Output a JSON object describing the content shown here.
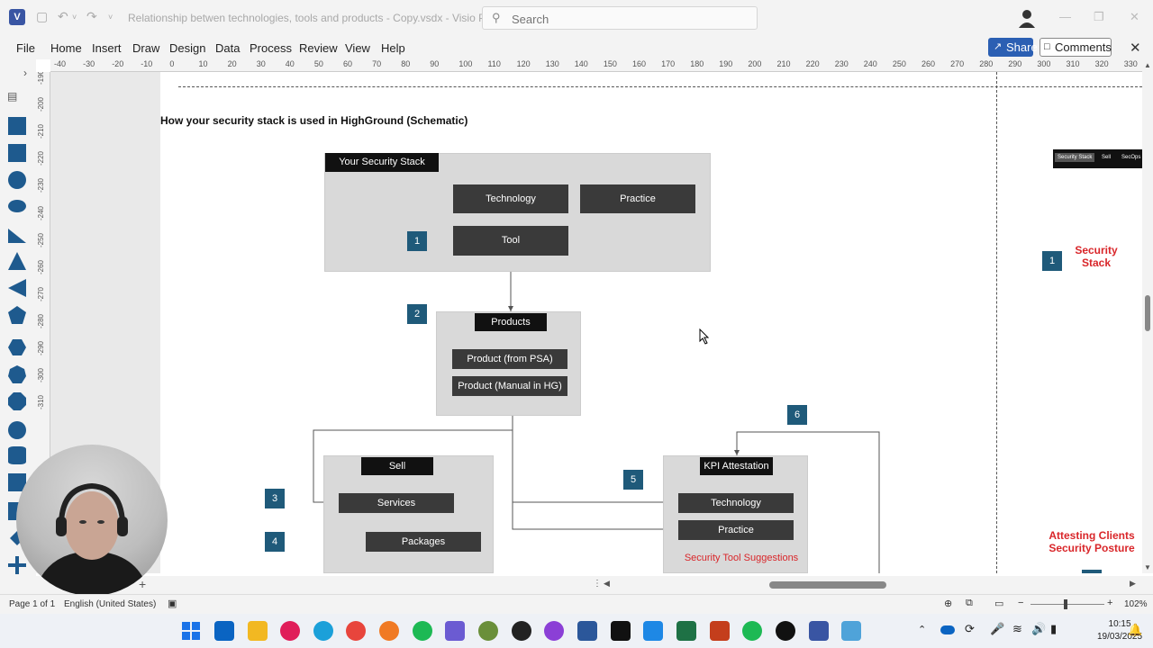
{
  "window": {
    "app_icon": "V",
    "doc_title": "Relationship betwen technologies, tools and products - Copy.vsdx  -  Visio Professi...",
    "search_placeholder": "Search"
  },
  "menu": {
    "items": [
      "File",
      "Home",
      "Insert",
      "Draw",
      "Design",
      "Data",
      "Process",
      "Review",
      "View",
      "Help"
    ],
    "share_label": "Share",
    "comments_label": "Comments"
  },
  "ruler": {
    "h_ticks": [
      "-40",
      "-30",
      "-20",
      "-10",
      "0",
      "10",
      "20",
      "30",
      "40",
      "50",
      "60",
      "70",
      "80",
      "90",
      "100",
      "110",
      "120",
      "130",
      "140",
      "150",
      "160",
      "170",
      "180",
      "190",
      "200",
      "210",
      "220",
      "230",
      "240",
      "250",
      "260",
      "270",
      "280",
      "290",
      "300",
      "310",
      "320",
      "330"
    ],
    "v_ticks": [
      "-190",
      "-200",
      "-210",
      "-220",
      "-230",
      "-240",
      "-250",
      "-260",
      "-270",
      "-280",
      "-290",
      "-300",
      "-310"
    ]
  },
  "diagram": {
    "title": "How your security stack is used in HighGround (Schematic)",
    "security_stack": {
      "header": "Your Security Stack",
      "technology": "Technology",
      "practice": "Practice",
      "tool": "Tool"
    },
    "products": {
      "header": "Products",
      "item1": "Product (from PSA)",
      "item2": "Product (Manual in HG)"
    },
    "sell": {
      "header": "Sell",
      "services": "Services",
      "packages": "Packages"
    },
    "kpi": {
      "header": "KPI Attestation",
      "technology": "Technology",
      "practice": "Practice",
      "suggestions": "Security Tool Suggestions"
    },
    "badges": [
      "1",
      "2",
      "3",
      "4",
      "5",
      "6"
    ],
    "right_panel": {
      "tabs": [
        "Security Stack",
        "Sell",
        "SecOps"
      ],
      "badge": "1",
      "label1": "Security\nStack",
      "label2": "Attesting Clients\nSecurity Posture"
    }
  },
  "status": {
    "page": "Page 1 of 1",
    "language": "English (United States)",
    "zoom": "102%"
  },
  "clock": {
    "time": "10:15",
    "date": "19/03/2025"
  },
  "colors": {
    "accent": "#2b5fb3",
    "badge": "#1f5a7a",
    "node": "#3a3a3a",
    "red": "#d9262a"
  }
}
